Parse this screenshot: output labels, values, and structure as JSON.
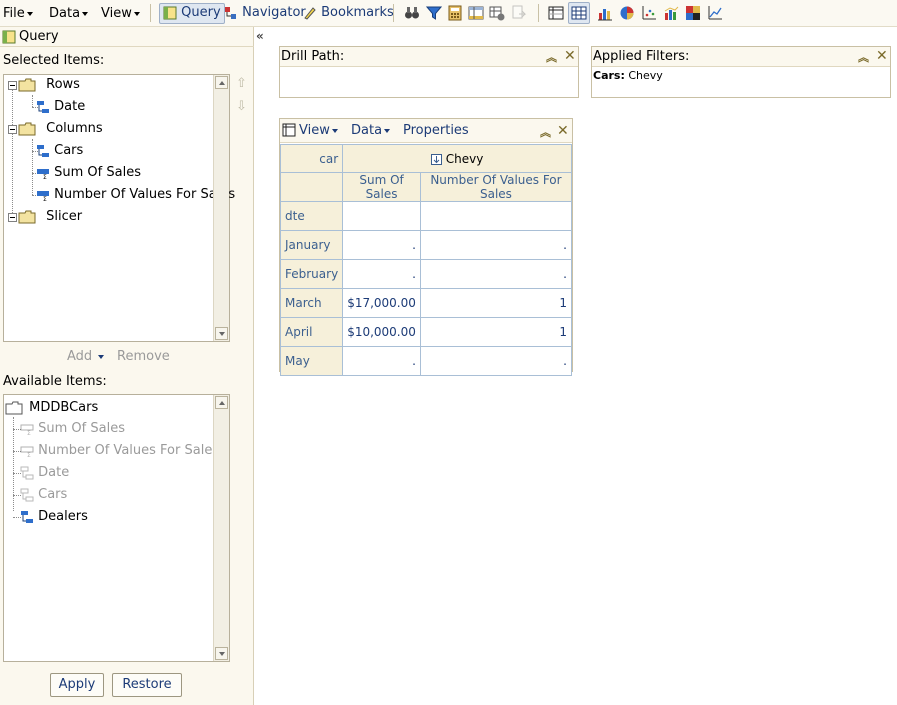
{
  "toolbar": {
    "file": "File",
    "data": "Data",
    "view": "View",
    "query": "Query",
    "navigator": "Navigator",
    "bookmarks": "Bookmarks"
  },
  "left": {
    "title": "Query",
    "selected_label": "Selected Items:",
    "selected_tree": {
      "rows": "Rows",
      "date": "Date",
      "columns": "Columns",
      "cars": "Cars",
      "sum_of_sales": "Sum Of Sales",
      "num_values": "Number Of Values For Sales",
      "slicer": "Slicer"
    },
    "add": "Add",
    "remove": "Remove",
    "available_label": "Available Items:",
    "available_tree": {
      "root": "MDDBCars",
      "sum_of_sales": "Sum Of Sales",
      "num_values": "Number Of Values For Sales",
      "date": "Date",
      "cars": "Cars",
      "dealers": "Dealers"
    },
    "apply": "Apply",
    "restore": "Restore"
  },
  "drill": {
    "title": "Drill Path:"
  },
  "filters": {
    "title": "Applied Filters:",
    "key": "Cars:",
    "value": "Chevy"
  },
  "grid": {
    "menu_view": "View",
    "menu_data": "Data",
    "menu_properties": "Properties",
    "corner_label": "car",
    "column_group": "Chevy",
    "measure_1": "Sum Of Sales",
    "measure_2": "Number Of Values For Sales",
    "row_dim": "dte",
    "rows": [
      {
        "label": "January",
        "sales": ".",
        "count": "."
      },
      {
        "label": "February",
        "sales": ".",
        "count": "."
      },
      {
        "label": "March",
        "sales": "$17,000.00",
        "count": "1"
      },
      {
        "label": "April",
        "sales": "$10,000.00",
        "count": "1"
      },
      {
        "label": "May",
        "sales": ".",
        "count": "."
      }
    ]
  }
}
